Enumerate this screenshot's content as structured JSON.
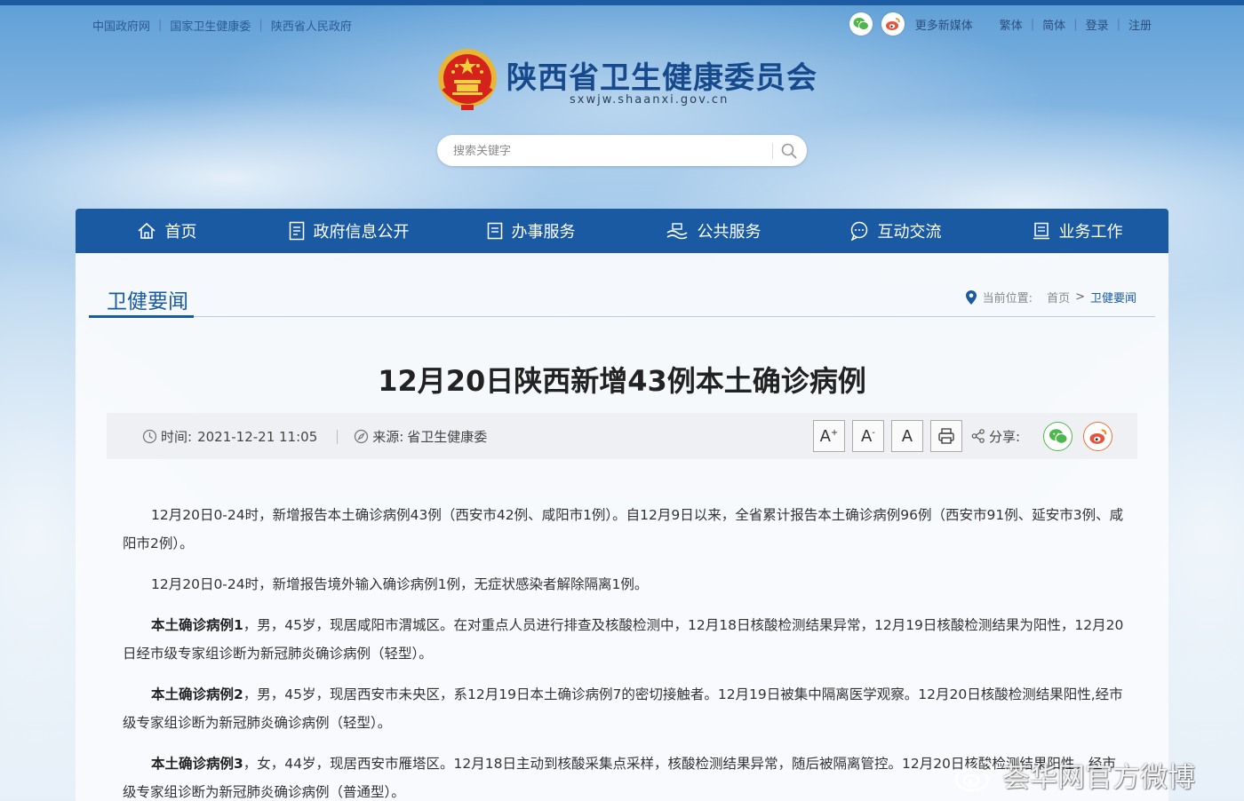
{
  "top_links": [
    "中国政府网",
    "国家卫生健康委",
    "陕西省人民政府"
  ],
  "top_right": {
    "more_media": "更多新媒体",
    "traditional": "繁体",
    "simplified": "简体",
    "login": "登录",
    "register": "注册"
  },
  "site": {
    "name": "陕西省卫生健康委员会",
    "domain": "sxwjw.shaanxi.gov.cn"
  },
  "search": {
    "placeholder": "搜索关键字"
  },
  "nav": [
    "首页",
    "政府信息公开",
    "办事服务",
    "公共服务",
    "互动交流",
    "业务工作"
  ],
  "section": {
    "title": "卫健要闻",
    "location_label": "当前位置:",
    "crumbs": [
      "首页",
      "卫健要闻"
    ]
  },
  "article": {
    "title": "12月20日陕西新增43例本土确诊病例",
    "time_label": "时间:",
    "time": "2021-12-21 11:05",
    "source_label": "来源:",
    "source": "省卫生健康委",
    "share_label": "分享:",
    "font_buttons": [
      "A",
      "A",
      "A"
    ],
    "paragraphs": [
      {
        "lead": "",
        "text": "12月20日0-24时，新增报告本土确诊病例43例（西安市42例、咸阳市1例）。自12月9日以来，全省累计报告本土确诊病例96例（西安市91例、延安市3例、咸阳市2例）。"
      },
      {
        "lead": "",
        "text": "12月20日0-24时，新增报告境外输入确诊病例1例，无症状感染者解除隔离1例。"
      },
      {
        "lead": "本土确诊病例1",
        "text": "，男，45岁，现居咸阳市渭城区。在对重点人员进行排查及核酸检测中，12月18日核酸检测结果异常，12月19日核酸检测结果为阳性，12月20日经市级专家组诊断为新冠肺炎确诊病例（轻型）。"
      },
      {
        "lead": "本土确诊病例2",
        "text": "，男，45岁，现居西安市未央区，系12月19日本土确诊病例7的密切接触者。12月19日被集中隔离医学观察。12月20日核酸检测结果阳性,经市级专家组诊断为新冠肺炎确诊病例（轻型）。"
      },
      {
        "lead": "本土确诊病例3",
        "text": "，女，44岁，现居西安市雁塔区。12月18日主动到核酸采集点采样，核酸检测结果异常，随后被隔离管控。12月20日核酸检测结果阳性，经市级专家组诊断为新冠肺炎确诊病例（普通型）。"
      }
    ]
  },
  "watermark": "荟华网官方微博",
  "icons": [
    "wechat-icon",
    "weibo-icon",
    "national-emblem-icon",
    "search-icon",
    "home-icon",
    "info-icon",
    "service-icon",
    "public-service-icon",
    "chat-icon",
    "work-icon",
    "location-pin-icon",
    "clock-icon",
    "compass-icon",
    "print-icon",
    "share-icon"
  ],
  "colors": {
    "brand_blue": "#1a5aa2",
    "wechat_green": "#4cb74a",
    "weibo_orange": "#e8743b"
  }
}
